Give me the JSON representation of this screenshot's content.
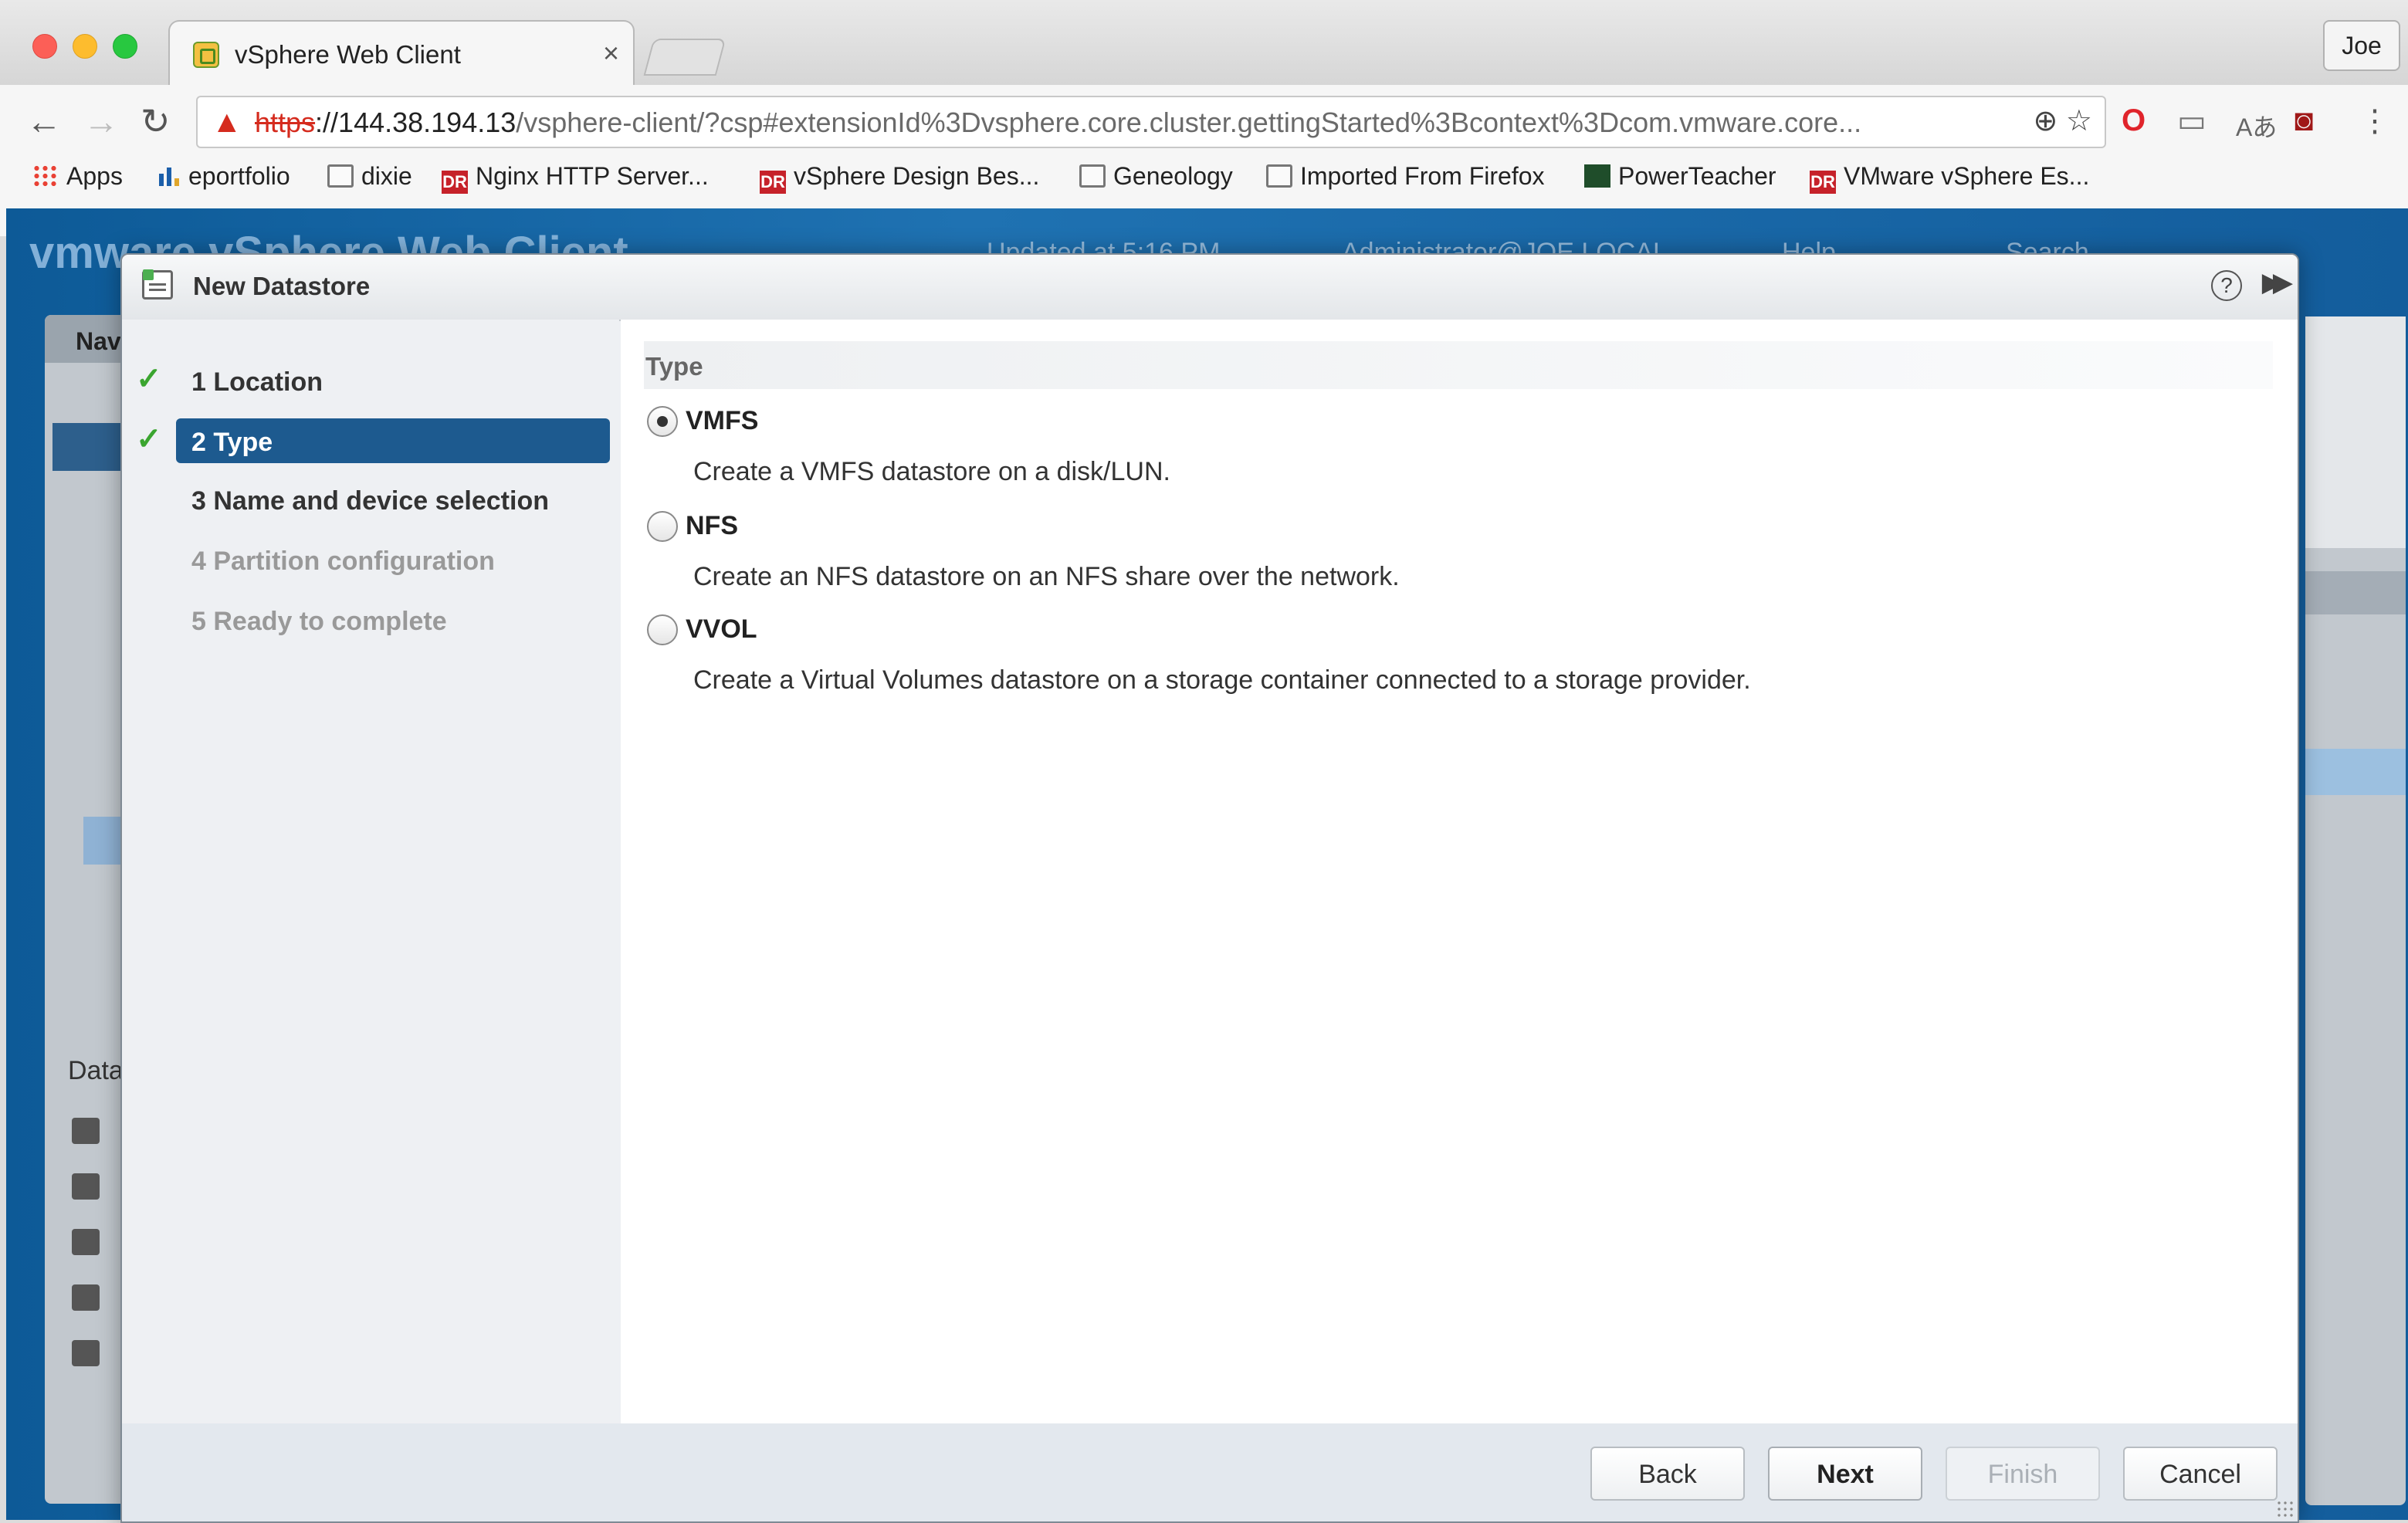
{
  "browser": {
    "tab_title": "vSphere Web Client",
    "tab_close": "×",
    "profile": "Joe",
    "url_scheme": "https",
    "url_host": "://144.38.194.13",
    "url_rest": "/vsphere-client/?csp#extensionId%3Dvsphere.core.cluster.gettingStarted%3Bcontext%3Dcom.vmware.core...",
    "nav": {
      "back": "←",
      "forward": "→",
      "reload": "↻"
    },
    "bookmarks": [
      {
        "label": "Apps",
        "icon": "apps-grid-icon"
      },
      {
        "label": "eportfolio",
        "icon": "chart-icon"
      },
      {
        "label": "dixie",
        "icon": "folder-icon"
      },
      {
        "label": "Nginx HTTP Server...",
        "icon": "dr-icon"
      },
      {
        "label": "vSphere Design Bes...",
        "icon": "dr-icon"
      },
      {
        "label": "Geneology",
        "icon": "folder-icon"
      },
      {
        "label": "Imported From Firefox",
        "icon": "folder-icon"
      },
      {
        "label": "PowerTeacher",
        "icon": "powerteacher-icon"
      },
      {
        "label": "VMware vSphere Es...",
        "icon": "dr-icon"
      }
    ]
  },
  "app": {
    "logo": "vmware vSphere Web Client",
    "header_status": "Updated at 5:16 PM",
    "header_user": "Administrator@JOE.LOCAL",
    "header_help": "Help",
    "header_search": "Search",
    "left_panel_title": "Nav",
    "left_panel_section": "Data"
  },
  "dialog": {
    "title": "New Datastore",
    "help": "?",
    "steps": [
      {
        "label": "1  Location",
        "state": "done"
      },
      {
        "label": "2  Type",
        "state": "current"
      },
      {
        "label": "3  Name and device selection",
        "state": "pending"
      },
      {
        "label": "4  Partition configuration",
        "state": "disabled"
      },
      {
        "label": "5  Ready to complete",
        "state": "disabled"
      }
    ],
    "section_title": "Type",
    "options": [
      {
        "label": "VMFS",
        "description": "Create a VMFS datastore on a disk/LUN.",
        "selected": true
      },
      {
        "label": "NFS",
        "description": "Create an NFS datastore on an NFS share over the network.",
        "selected": false
      },
      {
        "label": "VVOL",
        "description": "Create a Virtual Volumes datastore on a storage container connected to a storage provider.",
        "selected": false
      }
    ],
    "buttons": {
      "back": "Back",
      "next": "Next",
      "finish": "Finish",
      "cancel": "Cancel"
    }
  },
  "colors": {
    "current_step_bg": "#1d5a8f",
    "check_green": "#3aa52f",
    "app_blue": "#1f72b2"
  }
}
